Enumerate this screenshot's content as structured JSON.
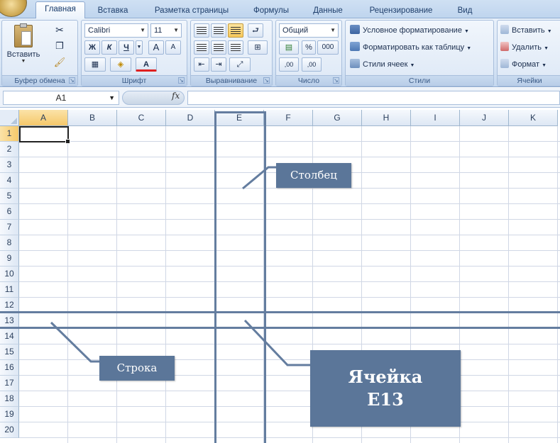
{
  "ribbon_tabs": [
    {
      "label": "Главная",
      "active": true
    },
    {
      "label": "Вставка",
      "active": false
    },
    {
      "label": "Разметка страницы",
      "active": false
    },
    {
      "label": "Формулы",
      "active": false
    },
    {
      "label": "Данные",
      "active": false
    },
    {
      "label": "Рецензирование",
      "active": false
    },
    {
      "label": "Вид",
      "active": false
    }
  ],
  "clipboard": {
    "paste_label": "Вставить",
    "group_label": "Буфер обмена"
  },
  "font": {
    "name": "Calibri",
    "size": "11",
    "bold": "Ж",
    "italic": "К",
    "underline": "Ч",
    "grow": "A",
    "shrink": "A",
    "color_glyph": "A",
    "group_label": "Шрифт"
  },
  "alignment": {
    "group_label": "Выравнивание"
  },
  "number": {
    "format": "Общий",
    "percent": "%",
    "thousands": "000",
    "inc_decimal": ",00",
    "dec_decimal": ",00",
    "group_label": "Число"
  },
  "styles": {
    "conditional": "Условное форматирование",
    "as_table": "Форматировать как таблицу",
    "cell_styles": "Стили ячеек",
    "group_label": "Стили"
  },
  "cells": {
    "insert": "Вставить",
    "delete": "Удалить",
    "format": "Формат",
    "group_label": "Ячейки"
  },
  "formula_bar": {
    "name_box": "A1",
    "fx": "fx",
    "formula": ""
  },
  "columns": [
    "A",
    "B",
    "C",
    "D",
    "E",
    "F",
    "G",
    "H",
    "I",
    "J",
    "K"
  ],
  "rows": [
    "1",
    "2",
    "3",
    "4",
    "5",
    "6",
    "7",
    "8",
    "9",
    "10",
    "11",
    "12",
    "13",
    "14",
    "15",
    "16",
    "17",
    "18",
    "19",
    "20"
  ],
  "active_cell": "A1",
  "annotations": {
    "column_label": "Столбец",
    "row_label": "Строка",
    "cell_label_line1": "Ячейка",
    "cell_label_line2": "E13"
  },
  "colors": {
    "accent": "#5b7699",
    "outline": "#647d9f",
    "active_header": "#f5c86a"
  }
}
